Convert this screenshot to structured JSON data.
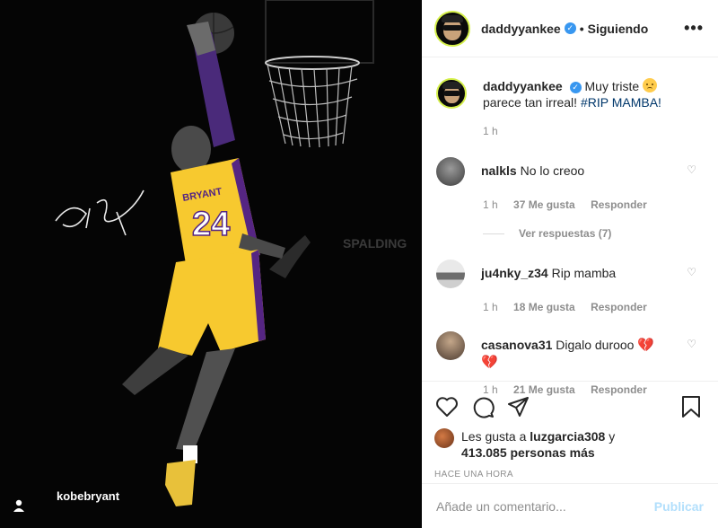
{
  "photo": {
    "tagged_user": "kobebryant",
    "jersey_name": "BRYANT",
    "jersey_number": "24",
    "brand_text": "SPALDING"
  },
  "header": {
    "username": "daddyyankee",
    "separator": "•",
    "follow_status": "Siguiendo",
    "more_label": "•••"
  },
  "caption": {
    "username": "daddyyankee",
    "text_before": "Muy triste",
    "text_line2": "parece tan irreal!",
    "hashtag": "#RIP MAMBA!",
    "time": "1 h"
  },
  "comments": [
    {
      "username": "nalkls",
      "text": "No lo creoo",
      "time": "1 h",
      "likes": "37 Me gusta",
      "reply": "Responder",
      "view_replies": "Ver respuestas (7)"
    },
    {
      "username": "ju4nky_z34",
      "text": "Rip mamba",
      "time": "1 h",
      "likes": "18 Me gusta",
      "reply": "Responder"
    },
    {
      "username": "casanova31",
      "text": "Digalo durooo",
      "time": "1 h",
      "likes": "21 Me gusta",
      "reply": "Responder"
    }
  ],
  "likes": {
    "prefix": "Les gusta a",
    "user": "luzgarcia308",
    "suffix": "y",
    "count": "413.085 personas más"
  },
  "posted": "HACE UNA HORA",
  "add_comment": {
    "placeholder": "Añade un comentario...",
    "post_label": "Publicar"
  },
  "colors": {
    "link": "#00376b",
    "verified": "#3897f0",
    "muted": "#8e8e8e",
    "publish_disabled": "#b2dffc",
    "lakers_gold": "#f7c92f",
    "lakers_purple": "#552583"
  },
  "icons": [
    "heart-icon",
    "comment-icon",
    "share-icon",
    "bookmark-icon",
    "user-tag-icon",
    "verified-icon",
    "more-icon"
  ]
}
